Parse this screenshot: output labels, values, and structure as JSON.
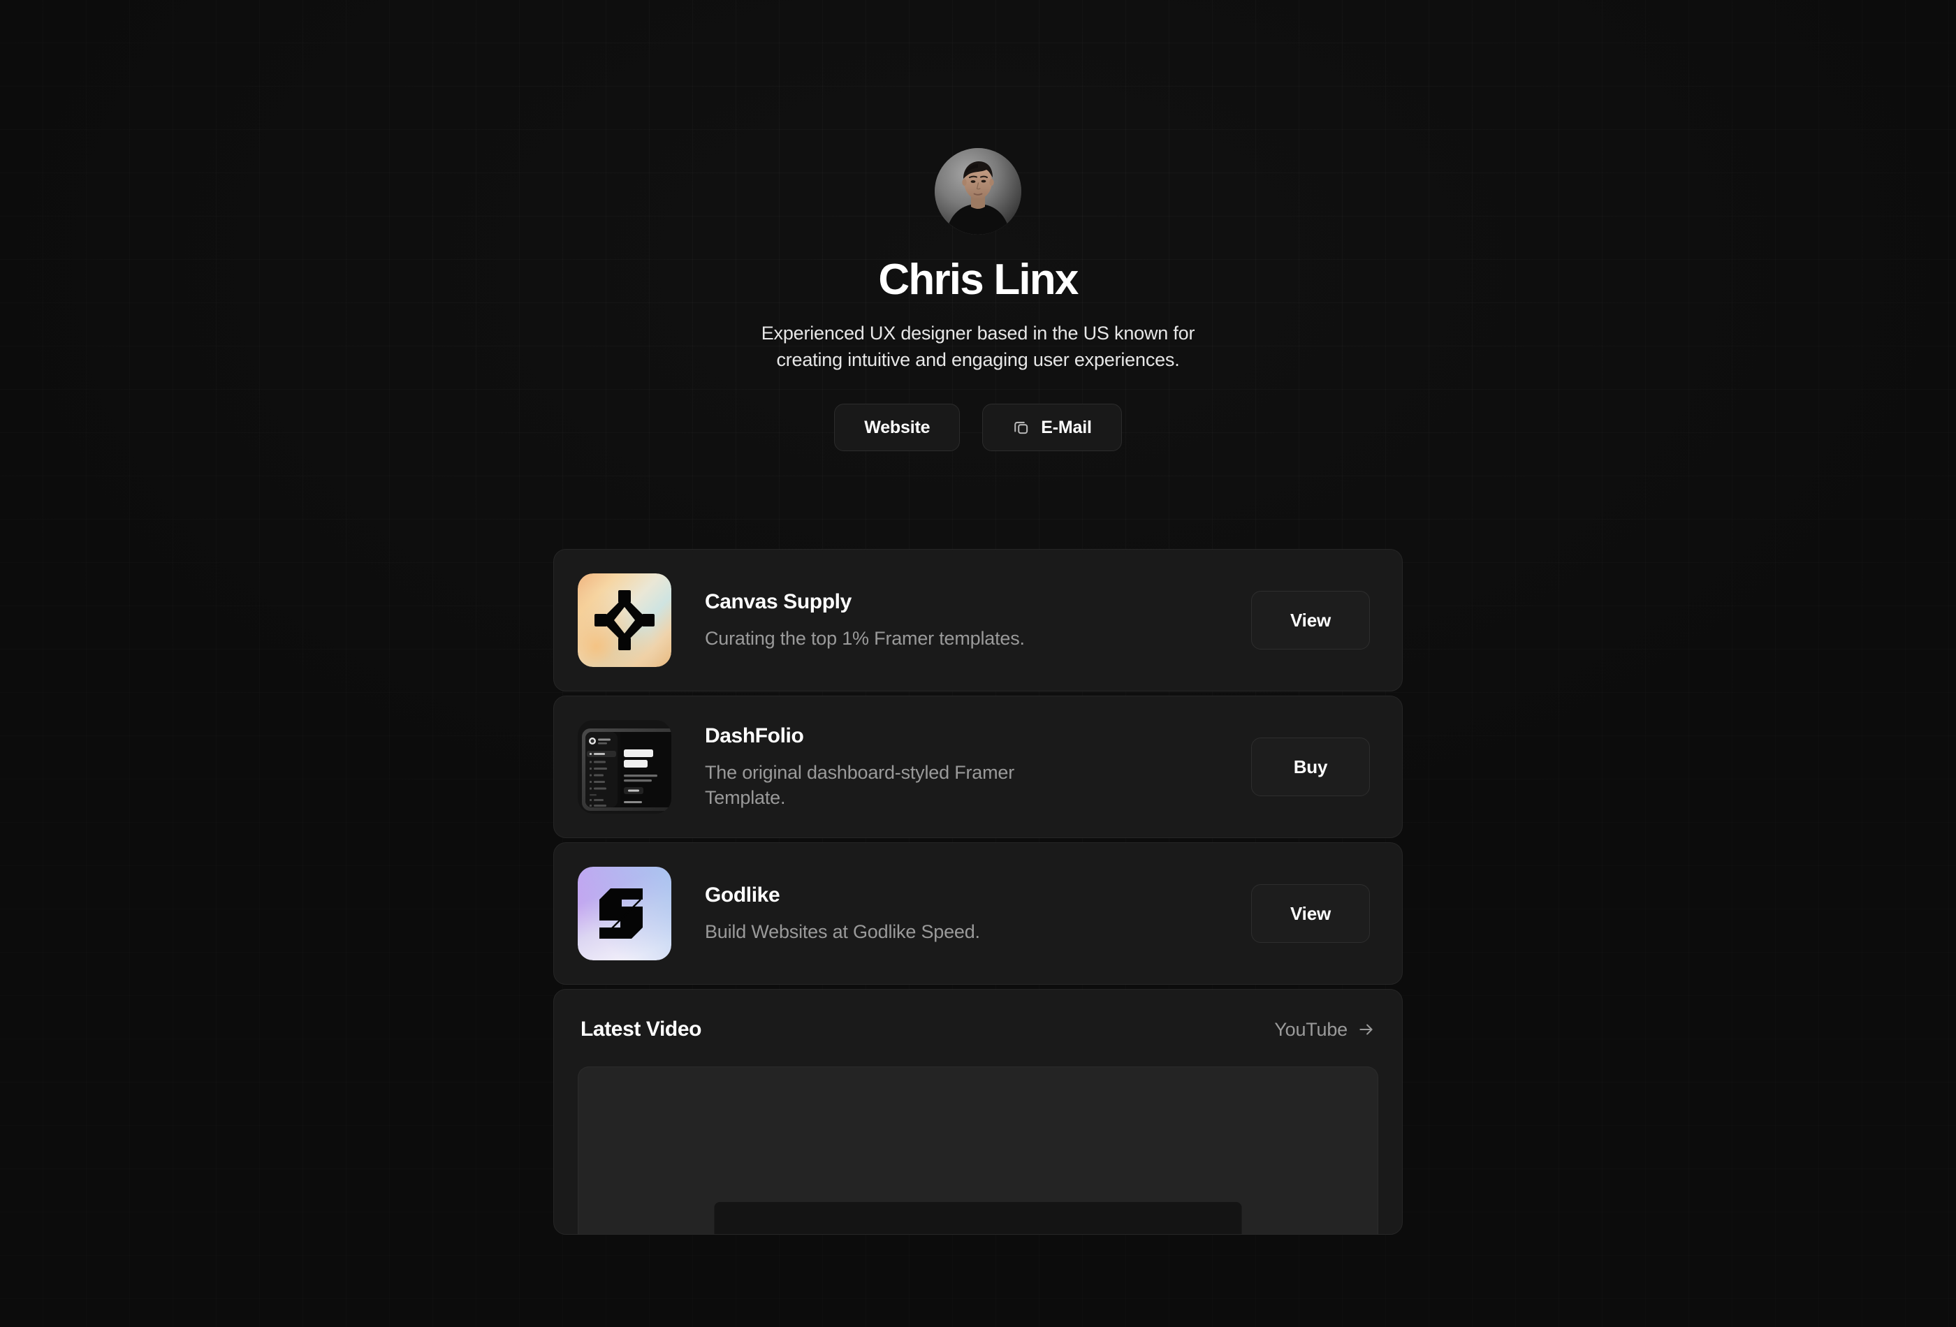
{
  "theme": {
    "page_bg": "#111111",
    "card_bg": "#1a1a1a",
    "card_border": "#262626",
    "text_primary": "#ffffff",
    "text_muted": "#9a9a9a"
  },
  "profile": {
    "name": "Chris Linx",
    "bio_line1": "Experienced UX designer based in the US known for",
    "bio_line2": "creating intuitive and engaging user experiences.",
    "avatar_alt": "Chris Linx portrait photo"
  },
  "hero_actions": [
    {
      "label": "Website",
      "icon": null
    },
    {
      "label": "E-Mail",
      "icon": "copy-icon"
    }
  ],
  "links": [
    {
      "title": "Canvas Supply",
      "description": "Curating the top 1% Framer templates.",
      "action_label": "View",
      "thumb": "canvas-supply-logo",
      "thumb_colors": [
        "#f3c08a",
        "#f7d7a3",
        "#e9e6d2",
        "#cfe3e0",
        "#e7cdb0"
      ]
    },
    {
      "title": "DashFolio",
      "description": "The original dashboard-styled Framer Template.",
      "action_label": "Buy",
      "thumb": "dashfolio-screenshot",
      "thumb_colors": [
        "#3a3a3a",
        "#161616",
        "#0e0e0e"
      ]
    },
    {
      "title": "Godlike",
      "description": "Build Websites at Godlike Speed.",
      "action_label": "View",
      "thumb": "godlike-logo",
      "thumb_colors": [
        "#c9a7f0",
        "#b9c8f2",
        "#e9e6f5",
        "#000000"
      ]
    }
  ],
  "latest_video": {
    "heading": "Latest Video",
    "link_label": "YouTube",
    "link_icon": "arrow-right-icon"
  }
}
